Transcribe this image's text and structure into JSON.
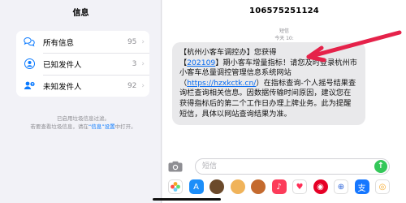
{
  "left": {
    "title": "信息",
    "items": [
      {
        "label": "所有信息",
        "count": "95",
        "icon": "chat-bubbles-icon"
      },
      {
        "label": "已知发件人",
        "count": "3",
        "icon": "person-circle-icon"
      },
      {
        "label": "未知发件人",
        "count": "92",
        "icon": "person-question-icon"
      }
    ],
    "note_line1": "已启用垃圾信息过滤。",
    "note_line2a": "若要查看垃圾信息，请在",
    "note_link": "“信息”设置",
    "note_line2b": "中打开。"
  },
  "conversation": {
    "sender": "106575251124",
    "timestamp_label": "短信",
    "timestamp_time": "今天 10:",
    "message_pre": "【杭州小客车调控办】",
    "message_hidden": "您获得",
    "message_date": "202109",
    "message_mid": "】期小客车增量指标！请您及时登录杭州市小客车总量调控管理信息系统网站（",
    "message_link": "https://hzxkctk.cn/",
    "message_post": "）在指标查询-个人摇号结果查询栏查询相关信息。因数据传输时间原因，建议您在获得指标后的第二个工作日办理上牌业务。此为提醒短信，具体以网站查询结果为准。",
    "message_bracket_open": "【",
    "input_placeholder": "短信",
    "send_glyph": "↑"
  },
  "colors": {
    "accent": "#0a7aff",
    "bubble": "#e9e9eb",
    "send": "#34c759",
    "annotation_arrow": "#e5224a"
  },
  "apps": [
    "photos-app-icon",
    "app-store-icon",
    "memoji-1-icon",
    "memoji-2-icon",
    "memoji-3-icon",
    "music-icon",
    "heart-app-icon",
    "netease-music-icon",
    "search-app-icon",
    "alipay-icon",
    "ring-app-icon"
  ]
}
